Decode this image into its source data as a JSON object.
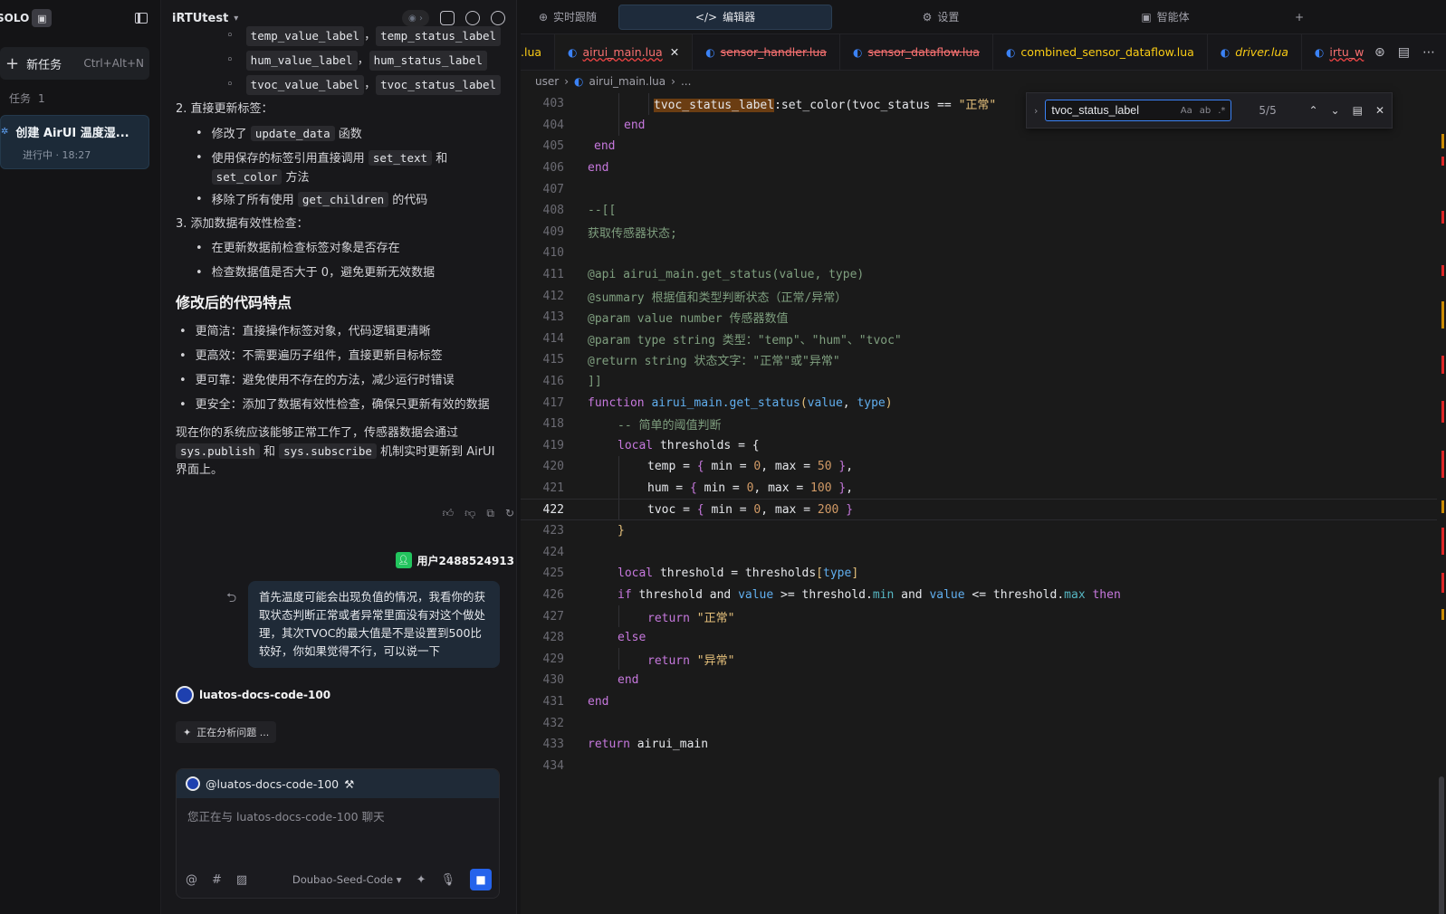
{
  "left": {
    "solo": "SOLO",
    "new_task": "新任务",
    "new_task_shortcut": "Ctrl+Alt+N",
    "tasks_label": "任务",
    "tasks_count": "1",
    "task": {
      "title": "创建 AirUI 温度湿...",
      "status": "进行中 · 18:27"
    }
  },
  "chat": {
    "project": "iRTUtest",
    "sub_items": [
      [
        "temp_value_label",
        "temp_status_label"
      ],
      [
        "hum_value_label",
        "hum_status_label"
      ],
      [
        "tvoc_value_label",
        "tvoc_status_label"
      ]
    ],
    "item2": "2. 直接更新标签：",
    "item2_b1_a": "修改了",
    "item2_b1_code": "update_data",
    "item2_b1_b": "函数",
    "item2_b2_a": "使用保存的标签引用直接调用",
    "item2_b2_code1": "set_text",
    "item2_b2_and": "和",
    "item2_b2_code2": "set_color",
    "item2_b2_b": "方法",
    "item2_b3_a": "移除了所有使用",
    "item2_b3_code": "get_children",
    "item2_b3_b": "的代码",
    "item3": "3. 添加数据有效性检查：",
    "item3_b1": "在更新数据前检查标签对象是否存在",
    "item3_b2": "检查数据值是否大于 0，避免更新无效数据",
    "heading": "修改后的代码特点",
    "features": [
      "更简洁：直接操作标签对象，代码逻辑更清晰",
      "更高效：不需要遍历子组件，直接更新目标标签",
      "更可靠：避免使用不存在的方法，减少运行时错误",
      "更安全：添加了数据有效性检查，确保只更新有效的数据"
    ],
    "summary_a": "现在你的系统应该能够正常工作了，传感器数据会通过",
    "summary_code1": "sys.publish",
    "summary_and": "和",
    "summary_code2": "sys.subscribe",
    "summary_b": "机制实时更新到 AirUI 界面上。",
    "user_name": "用户2488524913",
    "user_message": "首先温度可能会出现负值的情况，我看你的获取状态判断正常或者异常里面没有对这个做处理，其次TVOC的最大值是不是设置到500比较好，你如果觉得不行，可以说一下",
    "agent_name": "luatos-docs-code-100",
    "analyzing": "正在分析问题 ...",
    "composer_context": "@luatos-docs-code-100",
    "composer_placeholder": "您正在与 luatos-docs-code-100 聊天",
    "model": "Doubao-Seed-Code"
  },
  "editor": {
    "top_tabs": [
      "实时跟随",
      "编辑器",
      "设置",
      "智能体"
    ],
    "file_tabs": [
      {
        "name": ".lua",
        "style": "warn"
      },
      {
        "name": "airui_main.lua",
        "style": "err"
      },
      {
        "name": "sensor_handler.lua",
        "style": "strike"
      },
      {
        "name": "sensor_dataflow.lua",
        "style": "strike"
      },
      {
        "name": "combined_sensor_dataflow.lua",
        "style": "warn"
      },
      {
        "name": "driver.lua",
        "style": "warn"
      },
      {
        "name": "irtu_w",
        "style": "err"
      }
    ],
    "breadcrumb": [
      "user",
      "airui_main.lua",
      "..."
    ],
    "find": {
      "query": "tvoc_status_label",
      "count": "5/5",
      "opt1": "Aa",
      "opt2": "ab",
      "opt3": ".*"
    },
    "line_numbers": [
      "403",
      "404",
      "405",
      "406",
      "407",
      "408",
      "409",
      "410",
      "411",
      "412",
      "413",
      "414",
      "415",
      "416",
      "417",
      "418",
      "419",
      "420",
      "421",
      "422",
      "423",
      "424",
      "425",
      "426",
      "427",
      "428",
      "429",
      "430",
      "431",
      "432",
      "433",
      "434"
    ],
    "code": {
      "l403_a": "tvoc_status_label",
      "l403_b": ":set_color(tvoc_status == ",
      "l403_c": "\"正常\"",
      "end": "end",
      "l408": "--[[",
      "l409": "获取传感器状态;",
      "l411": "@api airui_main.get_status(value, type)",
      "l412": "@summary 根据值和类型判断状态（正常/异常）",
      "l413": "@param value number 传感器数值",
      "l414": "@param type string 类型：\"temp\"、\"hum\"、\"tvoc\"",
      "l415": "@return string 状态文字：\"正常\"或\"异常\"",
      "l416": "]]",
      "function": "function",
      "get_status": "airui_main.get_status",
      "params_open": "(",
      "value": "value",
      "comma": ", ",
      "type": "type",
      "params_close": ")",
      "l418": "-- 简单的阈值判断",
      "local": "local",
      "thresholds": "thresholds",
      "eq_brace": " = {",
      "temp": "temp",
      "hum": "hum",
      "tvoc": "tvoc",
      "min": "min",
      "max": "max",
      "t_min": "0",
      "t_max": "50",
      "h_min": "0",
      "h_max": "100",
      "v_min": "0",
      "v_max": "200",
      "close_brace": "}",
      "threshold": "threshold",
      "idx_open": "[",
      "idx_close": "]",
      "if": "if",
      "and": "and",
      "ge": " >= ",
      "le": " <= ",
      "dot": ".",
      "then": "then",
      "return": "return",
      "normal": "\"正常\"",
      "abnormal": "\"异常\"",
      "else": "else",
      "airui_main": "airui_main"
    }
  }
}
